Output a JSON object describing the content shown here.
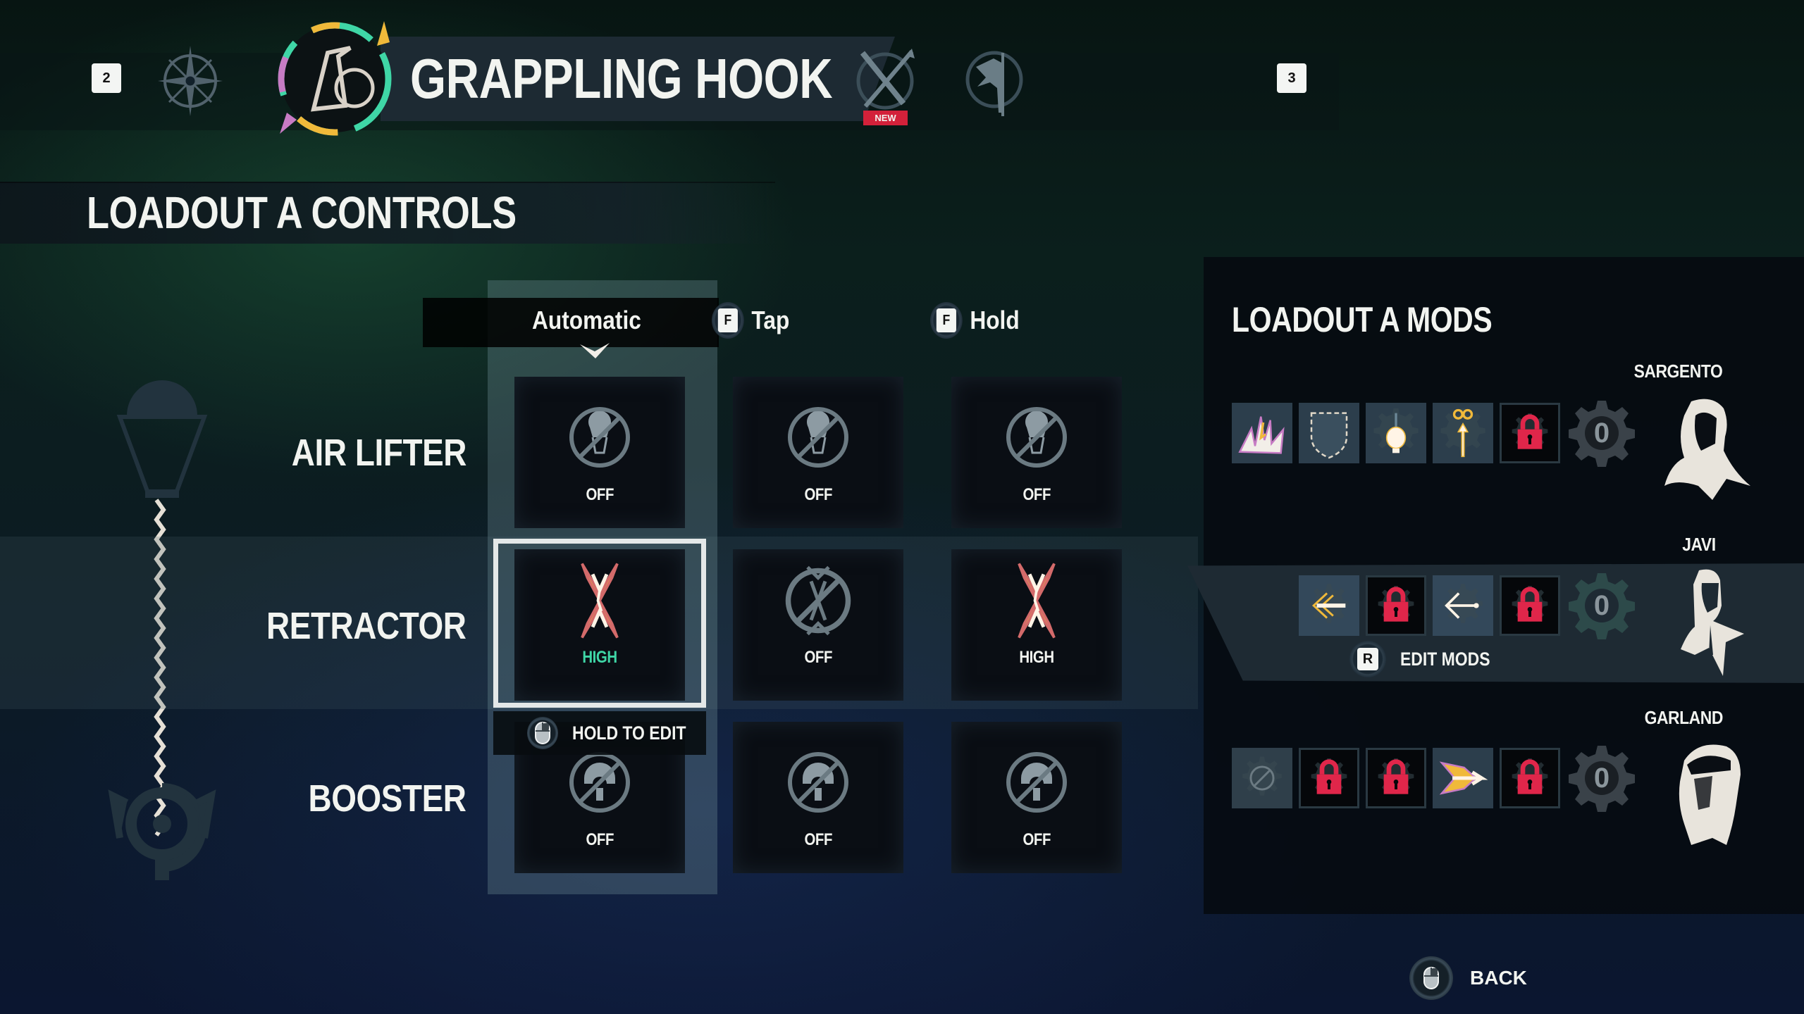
{
  "top_nav": {
    "prev_key": "2",
    "next_key": "3",
    "tabs": [
      {
        "icon": "compass-icon",
        "selected": false
      },
      {
        "icon": "grappling-hook-icon",
        "selected": true,
        "label": "GRAPPLING HOOK"
      },
      {
        "icon": "crossed-weapons-icon",
        "selected": false,
        "badge": "NEW"
      },
      {
        "icon": "fortress-icon",
        "selected": false
      }
    ],
    "colors": {
      "badge": "#d3213a"
    }
  },
  "controls": {
    "title": "LOADOUT A CONTROLS",
    "columns": [
      {
        "label": "Automatic",
        "key": null,
        "selected": true
      },
      {
        "label": "Tap",
        "key": "F"
      },
      {
        "label": "Hold",
        "key": "F"
      }
    ],
    "rows": [
      {
        "label": "AIR LIFTER",
        "cells": [
          {
            "state": "OFF",
            "icon": "air-lifter-off-icon"
          },
          {
            "state": "OFF",
            "icon": "air-lifter-off-icon"
          },
          {
            "state": "OFF",
            "icon": "air-lifter-off-icon"
          }
        ]
      },
      {
        "label": "RETRACTOR",
        "cells": [
          {
            "state": "HIGH",
            "icon": "retractor-high-icon",
            "selected": true
          },
          {
            "state": "OFF",
            "icon": "retractor-off-icon"
          },
          {
            "state": "HIGH",
            "icon": "retractor-high-icon"
          }
        ]
      },
      {
        "label": "BOOSTER",
        "cells": [
          {
            "state": "OFF",
            "icon": "booster-off-icon"
          },
          {
            "state": "OFF",
            "icon": "booster-off-icon"
          },
          {
            "state": "OFF",
            "icon": "booster-off-icon"
          }
        ]
      }
    ],
    "hint": {
      "key_icon": "mouse-icon",
      "label": "HOLD TO EDIT"
    },
    "colors": {
      "selected_state": "#3fd6a6"
    }
  },
  "mods": {
    "title": "LOADOUT A MODS",
    "characters": [
      {
        "name": "SARGENTO",
        "points": "0",
        "slots": [
          "explosion-mod-icon",
          "shield-mod-icon",
          "balloon-mod-icon",
          "infinite-arrow-mod-icon",
          "locked"
        ]
      },
      {
        "name": "JAVI",
        "points": "0",
        "selected": true,
        "slots": [
          "pull-arrow-mod-icon",
          "locked",
          "hook-pull-mod-icon",
          "locked"
        ]
      },
      {
        "name": "GARLAND",
        "points": "0",
        "slots": [
          "empty",
          "locked",
          "locked",
          "fire-arrow-mod-icon",
          "locked"
        ]
      }
    ],
    "edit": {
      "key": "R",
      "label": "EDIT MODS"
    },
    "colors": {
      "lock": "#e0264a"
    }
  },
  "footer": {
    "back": {
      "key_icon": "mouse-icon",
      "label": "BACK"
    }
  }
}
